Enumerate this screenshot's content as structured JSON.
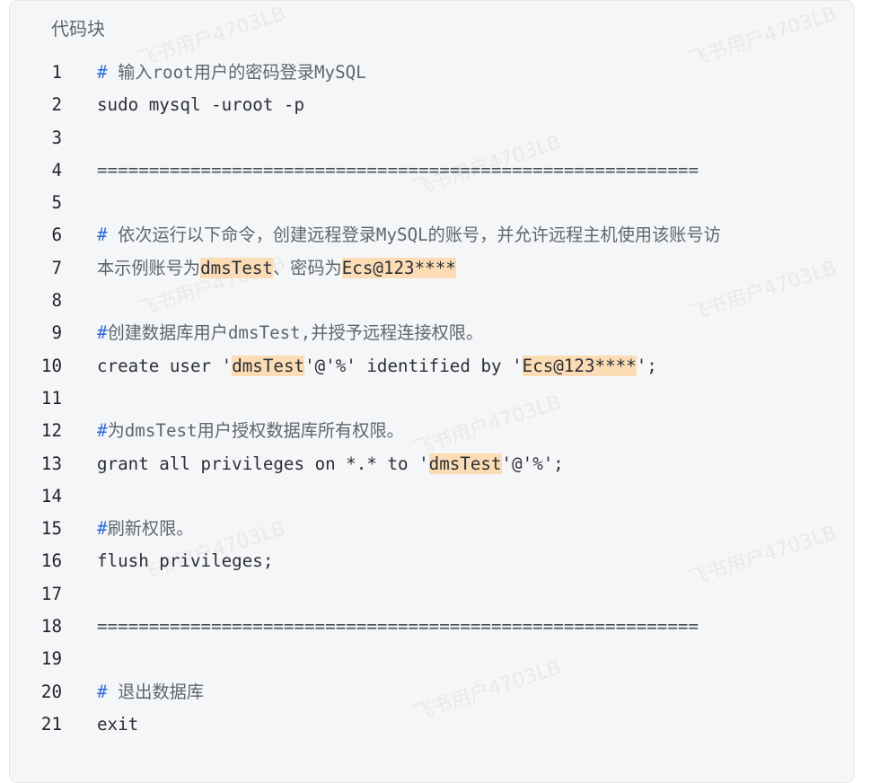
{
  "block": {
    "title": "代码块"
  },
  "watermark": "飞书用户4703LB",
  "lines": [
    {
      "n": "1",
      "parts": [
        {
          "t": "# ",
          "c": "hash"
        },
        {
          "t": "输入root用户的密码登录MySQL",
          "c": "cmt"
        }
      ]
    },
    {
      "n": "2",
      "parts": [
        {
          "t": "sudo mysql -uroot -p"
        }
      ]
    },
    {
      "n": "3",
      "parts": []
    },
    {
      "n": "4",
      "parts": [
        {
          "t": "==========================================================",
          "c": "sep"
        }
      ]
    },
    {
      "n": "5",
      "parts": []
    },
    {
      "n": "6",
      "parts": [
        {
          "t": "# ",
          "c": "hash"
        },
        {
          "t": "依次运行以下命令，创建远程登录MySQL的账号，并允许远程主机使用该账号访",
          "c": "cmt"
        }
      ]
    },
    {
      "n": "7",
      "parts": [
        {
          "t": "本示例账号为",
          "c": "cmt"
        },
        {
          "t": "dmsTest",
          "c": "hl"
        },
        {
          "t": "、密码为",
          "c": "cmt"
        },
        {
          "t": "Ecs@123****",
          "c": "hl"
        }
      ]
    },
    {
      "n": "8",
      "parts": []
    },
    {
      "n": "9",
      "parts": [
        {
          "t": "#",
          "c": "hash"
        },
        {
          "t": "创建数据库用户dmsTest,并授予远程连接权限。",
          "c": "cmt"
        }
      ]
    },
    {
      "n": "10",
      "parts": [
        {
          "t": "create user '"
        },
        {
          "t": "dmsTest",
          "c": "hl"
        },
        {
          "t": "'@'%' identified by '"
        },
        {
          "t": "Ecs@123****",
          "c": "hl"
        },
        {
          "t": "';"
        }
      ]
    },
    {
      "n": "11",
      "parts": []
    },
    {
      "n": "12",
      "parts": [
        {
          "t": "#",
          "c": "hash"
        },
        {
          "t": "为dmsTest用户授权数据库所有权限。",
          "c": "cmt"
        }
      ]
    },
    {
      "n": "13",
      "parts": [
        {
          "t": "grant all privileges on *.* to '"
        },
        {
          "t": "dmsTest",
          "c": "hl"
        },
        {
          "t": "'@'%';"
        }
      ]
    },
    {
      "n": "14",
      "parts": []
    },
    {
      "n": "15",
      "parts": [
        {
          "t": "#",
          "c": "hash"
        },
        {
          "t": "刷新权限。",
          "c": "cmt"
        }
      ]
    },
    {
      "n": "16",
      "parts": [
        {
          "t": "flush privileges;"
        }
      ]
    },
    {
      "n": "17",
      "parts": []
    },
    {
      "n": "18",
      "parts": [
        {
          "t": "==========================================================",
          "c": "sep"
        }
      ]
    },
    {
      "n": "19",
      "parts": []
    },
    {
      "n": "20",
      "parts": [
        {
          "t": "# ",
          "c": "hash"
        },
        {
          "t": "退出数据库",
          "c": "cmt"
        }
      ]
    },
    {
      "n": "21",
      "parts": [
        {
          "t": "exit"
        }
      ]
    }
  ]
}
